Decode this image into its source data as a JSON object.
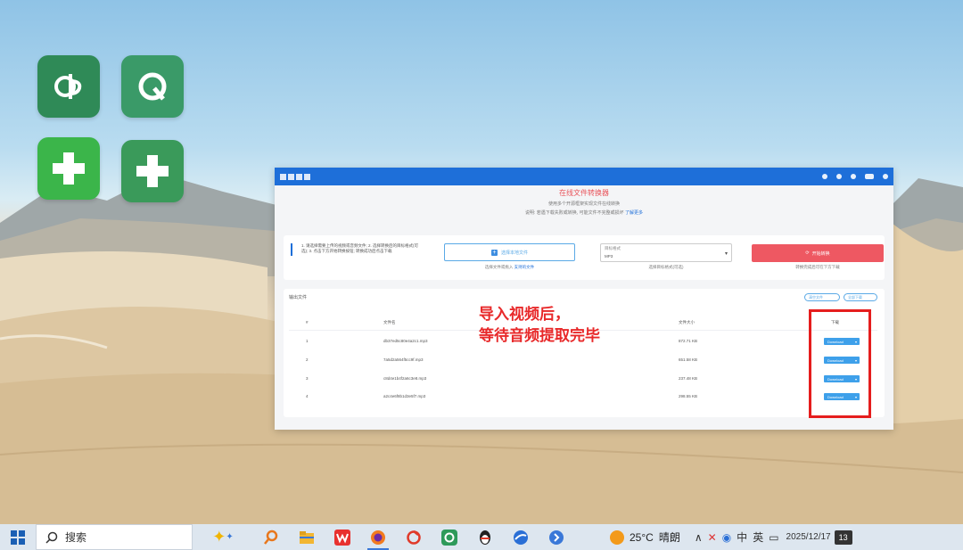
{
  "app": {
    "hero_title": "在线文件转换器",
    "hero_sub": "使用多个开源框架实现文件在线转换",
    "hero_sub2": "说明: 若遇下载失败或转换, 可能文件不完整或损坏",
    "hero_link": "了解更多",
    "tip_text": "1. 请选择需要上传的视频或音频文件; 2. 选择转换后的目标格式(可选); 3. 点击下方开始转换按钮; 转换成功后点击下载",
    "upload_label": "选择本地文件",
    "upload_note": "选择文件或拖入",
    "upload_note_link": "支持的文件",
    "format_label": "目标格式",
    "format_value": "MP3",
    "format_note": "选择目标格式(可选)",
    "convert_label": "开始转换",
    "convert_note": "转换完成后可在下方下载",
    "output_title": "输出文件",
    "pill_clear": "清空文件",
    "pill_download_all": "全部下载",
    "columns": [
      "#",
      "文件名",
      "文件大小",
      "下载"
    ],
    "rows": [
      {
        "index": "1",
        "name": "db37ed5c80e4a2c1.mp3",
        "size": "872.71 KB",
        "action": "Download"
      },
      {
        "index": "2",
        "name": "7a5d2a564f5cc9f.mp3",
        "size": "651.58 KB",
        "action": "Download"
      },
      {
        "index": "3",
        "name": "c8d4e1b4f2a6c3e8.mp3",
        "size": "237.48 KB",
        "action": "Download"
      },
      {
        "index": "4",
        "name": "a2c4e6f8b1d3e5f7.mp3",
        "size": "298.55 KB",
        "action": "Download"
      }
    ]
  },
  "annotation": {
    "line1": "导入视频后，",
    "line2": "等待音频提取完毕"
  },
  "taskbar": {
    "search_label": "搜索",
    "weather_temp": "25°C",
    "weather_desc": "晴朗",
    "ime_label": "英",
    "clock_date": "2025/12/17",
    "notif_count": "13"
  },
  "colors": {
    "accent": "#1e6fd9",
    "convert": "#ee5862",
    "annotation": "#e8292a"
  }
}
